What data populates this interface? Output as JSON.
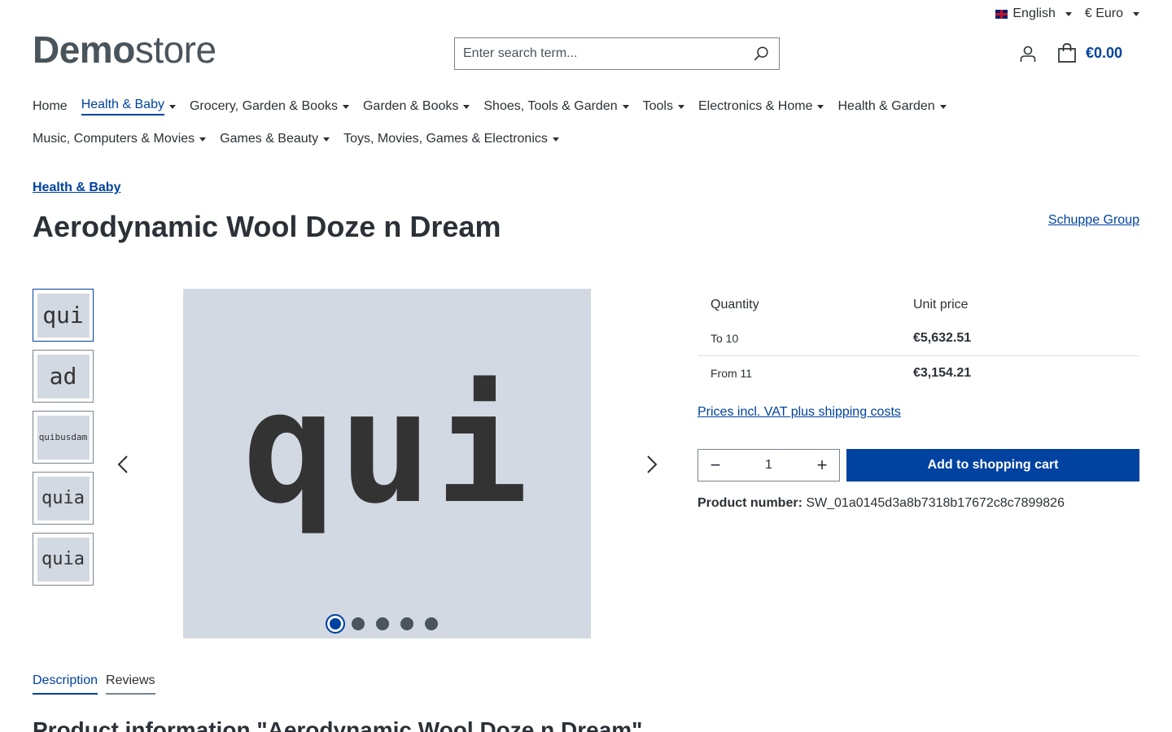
{
  "topbar": {
    "language": "English",
    "currency": "€ Euro"
  },
  "logo": {
    "bold": "Demo",
    "light": "store"
  },
  "search": {
    "placeholder": "Enter search term..."
  },
  "cart": {
    "total": "€0.00"
  },
  "nav": {
    "row1": [
      "Home",
      "Health & Baby",
      "Grocery, Garden & Books",
      "Garden & Books",
      "Shoes, Tools & Garden",
      "Tools",
      "Electronics & Home",
      "Health & Garden"
    ],
    "row2": [
      "Music, Computers & Movies",
      "Games & Beauty",
      "Toys, Movies, Games & Electronics"
    ]
  },
  "breadcrumb": "Health & Baby",
  "product": {
    "title": "Aerodynamic Wool Doze n Dream",
    "manufacturer": "Schuppe Group",
    "main_image_text": "qui",
    "thumbnails": [
      "qui",
      "ad",
      "quibusdam",
      "quia",
      "quia"
    ]
  },
  "pricing": {
    "col_quantity": "Quantity",
    "col_unit_price": "Unit price",
    "rows": [
      {
        "qty": "To 10",
        "price": "€5,632.51"
      },
      {
        "qty": "From 11",
        "price": "€3,154.21"
      }
    ],
    "vat_link": "Prices incl. VAT plus shipping costs"
  },
  "buy": {
    "quantity": "1",
    "add_label": "Add to shopping cart"
  },
  "product_number": {
    "label": "Product number:",
    "value": "SW_01a0145d3a8b7318b17672c8c7899826"
  },
  "tabs": [
    "Description",
    "Reviews"
  ],
  "info_title": "Product information \"Aerodynamic Wool Doze n Dream\""
}
